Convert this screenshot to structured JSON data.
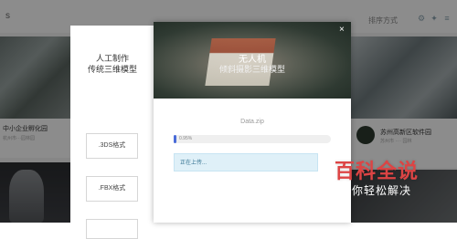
{
  "topbar": {
    "left_label": "s",
    "sort_label": "排序方式"
  },
  "cards": {
    "c1_title": "中小企业孵化园",
    "c1_sub": "杭州市···园林园",
    "c4_title": "苏州高新区软件园",
    "c4_sub": "苏州市 ···· 园林"
  },
  "left_panel": {
    "title_line1": "人工制作",
    "title_line2": "传统三维模型",
    "formats": [
      ".3DS格式",
      ".FBX格式"
    ]
  },
  "modal": {
    "banner_line1": "无人机",
    "banner_line2": "倾斜摄影三维模型",
    "close_icon": "×",
    "filename": "Data.zip",
    "progress_text": "0.95%",
    "progress_value": 0.0095,
    "status": "正在上传..."
  },
  "watermark": {
    "line1": "百科全说",
    "line2": "助你轻松解决"
  },
  "colors": {
    "accent": "#4a6bd8",
    "status_bg": "#dff0f8",
    "watermark": "#d44444"
  }
}
